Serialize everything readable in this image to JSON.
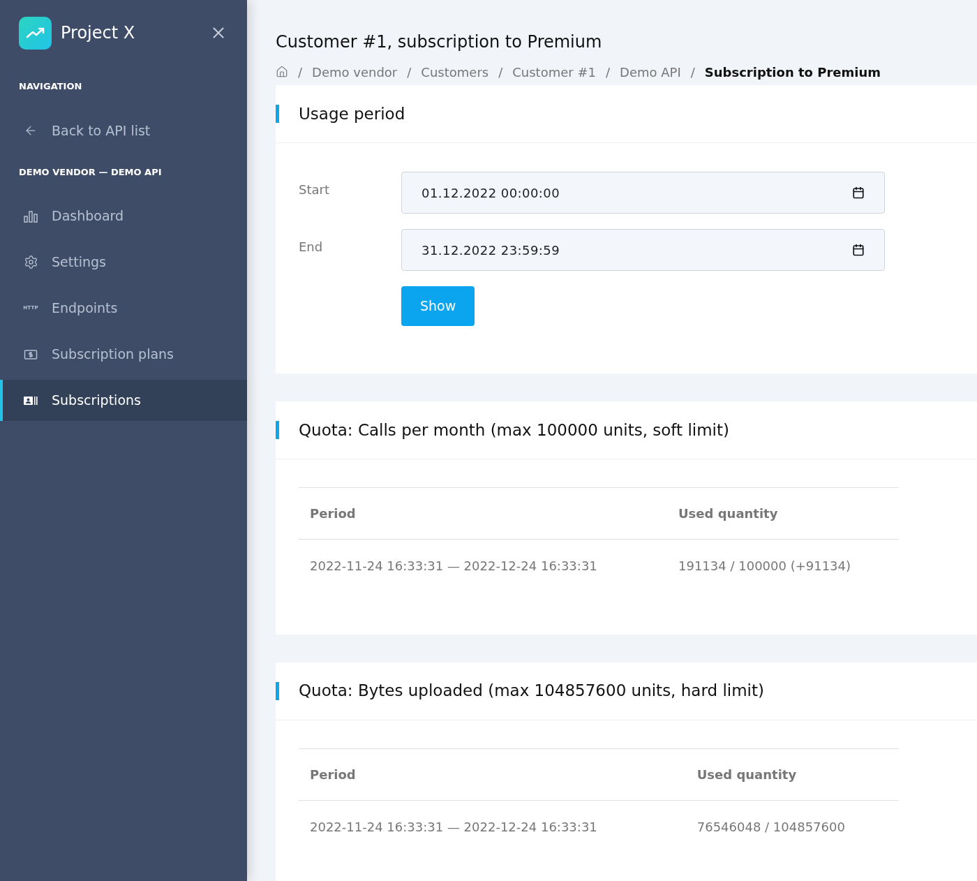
{
  "sidebar": {
    "app_name": "Project X",
    "sections": [
      {
        "heading": "NAVIGATION",
        "items": [
          {
            "kind": "back",
            "label": "Back to API list",
            "selected": false
          }
        ]
      },
      {
        "heading": "DEMO VENDOR — DEMO API",
        "items": [
          {
            "kind": "dashboard",
            "label": "Dashboard",
            "selected": false
          },
          {
            "kind": "settings",
            "label": "Settings",
            "selected": false
          },
          {
            "kind": "endpoints",
            "icon_text": "HTTP",
            "label": "Endpoints",
            "selected": false
          },
          {
            "kind": "plans",
            "label": "Subscription plans",
            "selected": false
          },
          {
            "kind": "subscriptions",
            "label": "Subscriptions",
            "selected": true
          }
        ]
      }
    ]
  },
  "page": {
    "title": "Customer #1, subscription to Premium",
    "breadcrumb_separator": "/",
    "breadcrumb": [
      "Demo vendor",
      "Customers",
      "Customer #1",
      "Demo API",
      "Subscription to Premium"
    ]
  },
  "usage_period": {
    "title": "Usage period",
    "fields": [
      {
        "label": "Start",
        "value": "01.12.2022 00:00:00"
      },
      {
        "label": "End",
        "value": "31.12.2022 23:59:59"
      }
    ],
    "button": "Show"
  },
  "quotas": [
    {
      "title": "Quota: Calls per month (max 100000 units, soft limit)",
      "columns": [
        "Period",
        "Used quantity"
      ],
      "rows": [
        [
          "2022-11-24 16:33:31 — 2022-12-24 16:33:31",
          "191134 / 100000 (+91134)"
        ]
      ]
    },
    {
      "title": "Quota: Bytes uploaded (max 104857600 units, hard limit)",
      "columns": [
        "Period",
        "Used quantity"
      ],
      "rows": [
        [
          "2022-11-24 16:33:31 — 2022-12-24 16:33:31",
          "76546048 / 104857600"
        ]
      ]
    }
  ]
}
